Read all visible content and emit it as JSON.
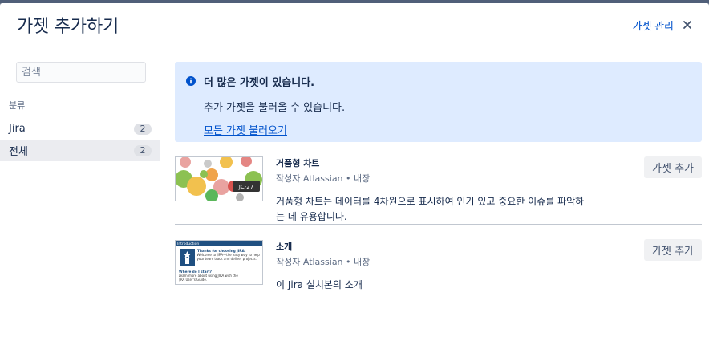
{
  "dialog": {
    "title": "가젯 추가하기",
    "manage_label": "가젯 관리"
  },
  "sidebar": {
    "search_placeholder": "검색",
    "category_heading": "분류",
    "categories": [
      {
        "label": "Jira",
        "count": "2",
        "selected": false
      },
      {
        "label": "전체",
        "count": "2",
        "selected": true
      }
    ]
  },
  "info": {
    "title": "더 많은 가젯이 있습니다.",
    "text": "추가 가젯을 불러올 수 있습니다.",
    "link": "모든 가젯 불러오기"
  },
  "gadgets": [
    {
      "title": "거품형 차트",
      "author": "작성자 Atlassian • 내장",
      "description": "거품형 차트는 데이터를 4차원으로 표시하여 인기 있고 중요한 이슈를 파악하는 데 유용합니다.",
      "add_label": "가젯 추가",
      "thumbnail_tag": "JC-27"
    },
    {
      "title": "소개",
      "author": "작성자 Atlassian • 내장",
      "description": "이 Jira 설치본의 소개",
      "add_label": "가젯 추가",
      "thumbnail": {
        "header": "Introduction",
        "heading": "Thanks for choosing JIRA.",
        "body": "Welcome to JIRA—the easy way to help your team track and deliver projects.",
        "subheading": "Where do I start?",
        "footer": "Learn more about using JIRA with the JIRA User's Guide."
      }
    }
  ],
  "colors": {
    "link": "#0052cc",
    "info_bg": "#deebff",
    "selected_bg": "#ebecf0"
  }
}
